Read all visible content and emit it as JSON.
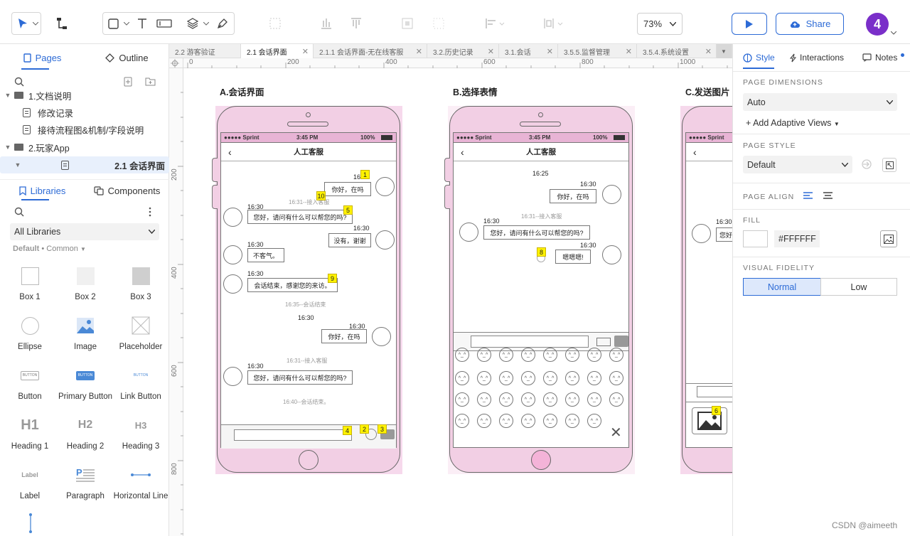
{
  "toolbar": {
    "zoom": "73%",
    "share": "Share",
    "avatar": "4"
  },
  "left": {
    "tab_pages": "Pages",
    "tab_outline": "Outline",
    "tree": [
      {
        "label": "1.文档说明"
      },
      {
        "label": "修改记录"
      },
      {
        "label": "接待流程图&机制/字段说明"
      },
      {
        "label": "2.玩家App"
      },
      {
        "label": "2.1 会话界面"
      }
    ],
    "tab_libraries": "Libraries",
    "tab_components": "Components",
    "library_select": "All Libraries",
    "lib_default": "Default",
    "lib_common": "• Common",
    "widgets": [
      {
        "label": "Box 1"
      },
      {
        "label": "Box 2"
      },
      {
        "label": "Box 3"
      },
      {
        "label": "Ellipse"
      },
      {
        "label": "Image"
      },
      {
        "label": "Placeholder"
      },
      {
        "label": "Button"
      },
      {
        "label": "Primary Button"
      },
      {
        "label": "Link Button"
      },
      {
        "label": "Heading 1"
      },
      {
        "label": "Heading 2"
      },
      {
        "label": "Heading 3"
      },
      {
        "label": "Label"
      },
      {
        "label": "Paragraph"
      },
      {
        "label": "Horizontal Line"
      }
    ],
    "widget_glyphs": {
      "h1": "H1",
      "h2": "H2",
      "h3": "H3",
      "label": "Label",
      "button": "BUTTON"
    }
  },
  "doc_tabs": [
    "2.2 游客验证",
    "2.1 会话界面",
    "2.1.1 会话界面-无在线客服",
    "3.2.历史记录",
    "3.1.会话",
    "3.5.5.监督管理",
    "3.5.4.系统设置"
  ],
  "ruler": {
    "h": [
      "0",
      "200",
      "400",
      "600",
      "800",
      "1000"
    ],
    "v": [
      "200",
      "400",
      "600",
      "800"
    ]
  },
  "canvas": {
    "screen_a": {
      "title": "A.会话界面",
      "carrier": "●●●●● Sprint",
      "time": "3:45 PM",
      "battery": "100%",
      "nav": "人工客服",
      "t1": "16:30",
      "m1": "你好，在吗",
      "sys1": "16:31--接入客服",
      "t2": "16:30",
      "m2": "您好，请问有什么可以帮您的吗?",
      "t3": "16:30",
      "m3": "没有，谢谢",
      "t4": "16:30",
      "m4": "不客气。",
      "t5": "16:30",
      "m5": "会话结束，感谢您的来访。",
      "sys2": "16:35--会话结束",
      "t6": "16:30",
      "t7": "16:30",
      "m6": "你好，在吗",
      "sys3": "16:31--接入客服",
      "t8": "16:30",
      "m7": "您好，请问有什么可以帮您的吗?",
      "sys4": "16:40--会话结束。",
      "notes": [
        "1",
        "10",
        "5",
        "9",
        "4",
        "2",
        "3"
      ]
    },
    "screen_b": {
      "title": "B.选择表情",
      "carrier": "●●●●● Sprint",
      "time": "3:45 PM",
      "battery": "100%",
      "nav": "人工客服",
      "t0": "16:25",
      "t1": "16:30",
      "m1": "你好，在吗",
      "sys1": "16:31--接入客服",
      "t2": "16:30",
      "m2": "您好，请问有什么可以帮您的吗?",
      "t3": "16:30",
      "m3": "嗯嗯嗯!",
      "note": "8",
      "emoji": "^_^",
      "close": "✕"
    },
    "screen_c": {
      "title": "C.发送图片",
      "carrier": "●●●●● Sprint",
      "t1": "16:30",
      "m1": "您好",
      "note": "6"
    }
  },
  "right": {
    "tab_style": "Style",
    "tab_interactions": "Interactions",
    "tab_notes": "Notes",
    "page_dimensions": "PAGE DIMENSIONS",
    "dimensions_value": "Auto",
    "adaptive": "+ Add Adaptive Views",
    "page_style": "PAGE STYLE",
    "page_style_value": "Default",
    "page_align": "PAGE ALIGN",
    "fill": "FILL",
    "fill_value": "#FFFFFF",
    "visual_fidelity": "VISUAL FIDELITY",
    "normal": "Normal",
    "low": "Low"
  },
  "watermark": "CSDN @aimeeth"
}
